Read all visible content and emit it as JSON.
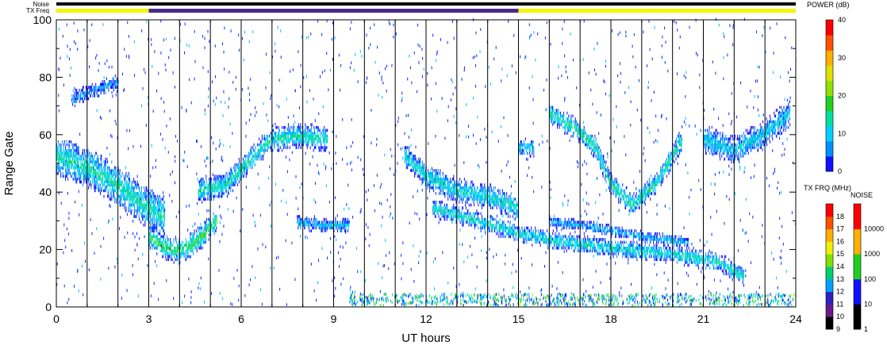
{
  "chart_data": {
    "type": "heatmap",
    "xlabel": "UT hours",
    "ylabel": "Range Gate",
    "xlim": [
      0,
      24
    ],
    "ylim": [
      0,
      100
    ],
    "x_ticks": [
      "0",
      "3",
      "6",
      "9",
      "12",
      "15",
      "18",
      "21",
      "24"
    ],
    "y_ticks": [
      "0",
      "20",
      "40",
      "60",
      "80",
      "100"
    ],
    "hour_lines": [
      1,
      2,
      3,
      4,
      5,
      6,
      7,
      8,
      9,
      10,
      11,
      12,
      13,
      14,
      15,
      16,
      17,
      18,
      19,
      20,
      21,
      22,
      23
    ],
    "bars": {
      "noise_label": "Noise",
      "txfreq_label": "TX Freq",
      "noise_color": "#000000",
      "txfreq_segments": [
        {
          "start": 0,
          "end": 3,
          "color": "#f5f500"
        },
        {
          "start": 3,
          "end": 15,
          "color": "#4a2a8a"
        },
        {
          "start": 15,
          "end": 24,
          "color": "#f5f500"
        }
      ]
    },
    "power_scale": {
      "title": "POWER (dB)",
      "ticks": [
        "0",
        "10",
        "20",
        "30",
        "40"
      ],
      "colors": [
        "#1010ff",
        "#0090ff",
        "#00d0ff",
        "#00e0a0",
        "#20d020",
        "#90e000",
        "#e0e000",
        "#ffb000",
        "#ff5000",
        "#ff0000"
      ]
    },
    "txfreq_scale": {
      "title": "TX FRQ (MHz)",
      "ticks": [
        "9",
        "10",
        "11",
        "12",
        "13",
        "14",
        "15",
        "16",
        "17",
        "18"
      ],
      "colors": [
        "#000000",
        "#6a1a8a",
        "#3020c0",
        "#00a0ff",
        "#00d070",
        "#80e000",
        "#f0f000",
        "#ffb000",
        "#ff5000",
        "#ff0000"
      ]
    },
    "noise_scale": {
      "title": "NOISE",
      "ticks": [
        "1",
        "10",
        "100",
        "1000",
        "10000"
      ],
      "colors": [
        "#000000",
        "#1010ff",
        "#20d020",
        "#ffb000",
        "#ff0000"
      ]
    },
    "echo_bands": [
      {
        "t": [
          0.0,
          1.0,
          2.0,
          2.8,
          3.5
        ],
        "g": [
          52,
          48,
          42,
          35,
          31
        ],
        "w": 6,
        "p": 14
      },
      {
        "t": [
          3.0,
          3.4,
          3.9,
          4.4,
          4.8,
          5.2
        ],
        "g": [
          24,
          21,
          19,
          21,
          25,
          30
        ],
        "w": 3.5,
        "p": 18
      },
      {
        "t": [
          4.6,
          5.5,
          6.5,
          7.0,
          7.8,
          8.8
        ],
        "g": [
          40,
          42,
          53,
          58,
          59,
          58
        ],
        "w": 3.5,
        "p": 14
      },
      {
        "t": [
          7.8,
          8.5,
          9.5
        ],
        "g": [
          29,
          28,
          28
        ],
        "w": 2,
        "p": 9
      },
      {
        "t": [
          11.3,
          12.0,
          13.0,
          14.0,
          15.0
        ],
        "g": [
          52,
          45,
          40,
          38,
          34
        ],
        "w": 3.5,
        "p": 13
      },
      {
        "t": [
          12.2,
          13.5,
          15.0,
          16.5,
          18.0,
          20.0,
          21.5,
          22.3
        ],
        "g": [
          34,
          30,
          25,
          22,
          20,
          18,
          15,
          10
        ],
        "w": 2.5,
        "p": 13
      },
      {
        "t": [
          16.0,
          17.0,
          18.0,
          19.0,
          20.5
        ],
        "g": [
          29,
          28,
          26,
          24,
          22
        ],
        "w": 1.5,
        "p": 9
      },
      {
        "t": [
          16.0,
          16.8,
          17.5,
          18.0,
          18.7,
          19.5,
          20.3
        ],
        "g": [
          67,
          62,
          55,
          42,
          35,
          43,
          58
        ],
        "w": 3,
        "p": 15
      },
      {
        "t": [
          21.0,
          22.0,
          23.0,
          23.8
        ],
        "g": [
          58,
          54,
          60,
          67
        ],
        "w": 4,
        "p": 11
      },
      {
        "t": [
          15.0,
          15.5
        ],
        "g": [
          55,
          55
        ],
        "w": 2.5,
        "p": 11
      },
      {
        "t": [
          0.5,
          1.5,
          2.0
        ],
        "g": [
          72,
          76,
          78
        ],
        "w": 2,
        "p": 7
      }
    ]
  }
}
